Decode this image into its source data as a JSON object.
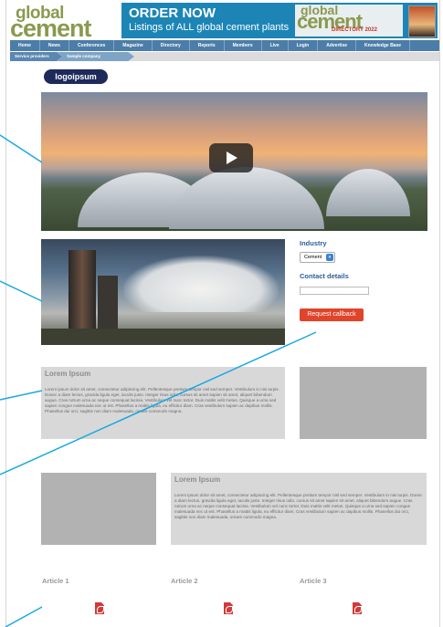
{
  "header": {
    "logo_line1": "global",
    "logo_line2": "cement",
    "banner_title": "ORDER NOW",
    "banner_subtitle": "Listings of ALL global cement plants",
    "directory_line1": "global",
    "directory_line2": "cement",
    "directory_line3": "DIRECTORY 2022"
  },
  "nav": {
    "items": [
      "Home",
      "News",
      "Conferences",
      "Magazine",
      "Directory",
      "Reports",
      "Members",
      "Live",
      "Login",
      "Advertise",
      "Knowledge Base"
    ]
  },
  "breadcrumb": {
    "items": [
      "Service providers",
      "Sample company"
    ]
  },
  "company": {
    "logo_text": "logoipsum"
  },
  "sidebar": {
    "industry_label": "Industry",
    "industry_value": "Cement",
    "contact_label": "Contact details",
    "callback_button": "Request callback"
  },
  "content": {
    "block1": {
      "title": "Lorem Ipsum",
      "body": "Lorem ipsum dolor sit amet, consectetur adipiscing elit. Pellentesque pretium tempor nisl sed semper. Vestibulum in nisi turpis. Donec a diam lectus, gravida ligula eget, iaculis justo. Integer risus odio, cursus sit amet sapien sit amet, aliquet bibendum augue. Cras rutrum urna ac neque consequat lacinia. Vestibulum vel nunc tortor. Duis mattis velit metus. Quisque a urna sed sapien congue malesuada nec ut est. Phasellus a mattis ligula, eu efficitur diam. Cras vestibulum sapien ac dapibus mollis. Phasellus dui orci, sagittis non diam malesuada, ornare commodo magna."
    },
    "block2": {
      "title": "Lorem Ipsum",
      "body": "Lorem ipsum dolor sit amet, consectetur adipiscing elit. Pellentesque pretium tempor nisl sed semper. Vestibulum in nisi turpis. Donec a diam lectus, gravida ligula eget, iaculis justo. Integer risus odio, cursus sit amet sapien sit amet, aliquet bibendum augue. Cras rutrum urna ac neque consequat lacinia. Vestibulum vel nunc tortor. Duis mattis velit metus. Quisque a urna sed sapien congue malesuada nec ut est. Phasellus a mattis ligula, eu efficitur diam. Cras vestibulum sapien ac dapibus mollis. Phasellus dui orci, sagittis non diam malesuada, ornare commodo magna."
    }
  },
  "articles": [
    {
      "title": "Article 1",
      "icon": "pdf-icon"
    },
    {
      "title": "Article 2",
      "icon": "pdf-icon"
    },
    {
      "title": "Article 3",
      "icon": "pdf-icon"
    }
  ],
  "colors": {
    "brand_green": "#8a9a4e",
    "nav_blue": "#4c7da8",
    "banner_blue": "#1c85b6",
    "button_red": "#e0442a",
    "annotation_cyan": "#1aa9e0"
  }
}
